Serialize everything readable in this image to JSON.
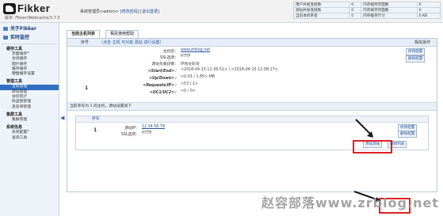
{
  "header": {
    "logo_text": "Fikker",
    "version": "版本: Fikker/Webcache/3.7.5",
    "admin_prefix": "系统管理员<admin>",
    "change_password": "修改密码",
    "logout": "退出登录"
  },
  "stats": {
    "rows": [
      [
        "用户并发连接数",
        "0",
        "内存缓存页面数",
        "0"
      ],
      [
        "源站并发连接数",
        "0",
        "内存缓存页面数",
        "0"
      ],
      [
        "当前本机带宽",
        "0",
        "内存缓存尺寸",
        "0 KB"
      ]
    ]
  },
  "sidebar": {
    "top": [
      {
        "label": "关于Fikker"
      },
      {
        "label": "实时监控"
      }
    ],
    "groups": [
      {
        "title": "缓存工具",
        "items": [
          "页面缓存*",
          "会话缓存",
          "图片缓存",
          "缓存缓存",
          "硬盘缓存设置"
        ]
      },
      {
        "title": "管理工具",
        "items": [
          "主机管理",
          "转向管理",
          "访问统计",
          "防盗链管理",
          "黑名单管理"
        ]
      },
      {
        "title": "集群工具",
        "items": [
          "集群管理"
        ]
      },
      {
        "title": "系统信息",
        "items": [
          "系统配置*",
          "查询工具"
        ]
      }
    ],
    "active_item": "主机管理",
    "collapse_glyph": "◀"
  },
  "tabs": [
    "当前主机列表",
    "相关使用帮助"
  ],
  "host_table": {
    "col_index": "序号",
    "col_title_prefix": "（点击 主机 可对其 源站 进行设置）",
    "col_action": "相关操作",
    "row_index": "1",
    "fields": [
      {
        "key": "主机名：",
        "value": "www.zrblog.net",
        "link": true
      },
      {
        "key": "SSL选项：",
        "value": "HTTP",
        "link": false
      },
      {
        "key": "源站负载均衡：",
        "value": "IP地址轮询",
        "link": false
      },
      {
        "key": "<Start/End>：",
        "value": "<2018-04-15 11:36:51> / <2018-04-15 12:08:17>",
        "link": false
      },
      {
        "key": "<Up/Down>：",
        "value": "<0.03 / 1.85> MB",
        "link": false
      },
      {
        "key": "<Requests/IP>：",
        "value": "<53 / 1>",
        "link": false
      },
      {
        "key": "<UC1/UC2>：",
        "value": "<0 / 0>",
        "link": false
      }
    ],
    "modify_button": "修改配置",
    "delete_button": "删除配置"
  },
  "source_note": "当前序号为  1  的主机，源站设置如下",
  "source_table": {
    "col_index": "序号",
    "row_index": "1",
    "ip_key": "源站IP：",
    "ip_value": "12.34.56.78",
    "ssl_key": "SSL选项：",
    "ssl_value": "HTTP",
    "modify_button": "修改配置",
    "delete_button": "删除配置",
    "add_button": "添加源站",
    "refresh_button": "刷新列表"
  },
  "watermark": "赵容部落www.zrblog.net",
  "colors": {
    "highlight": "#e02020",
    "link": "#1f4e9a",
    "sidebar_active": "#2f6fbf"
  }
}
